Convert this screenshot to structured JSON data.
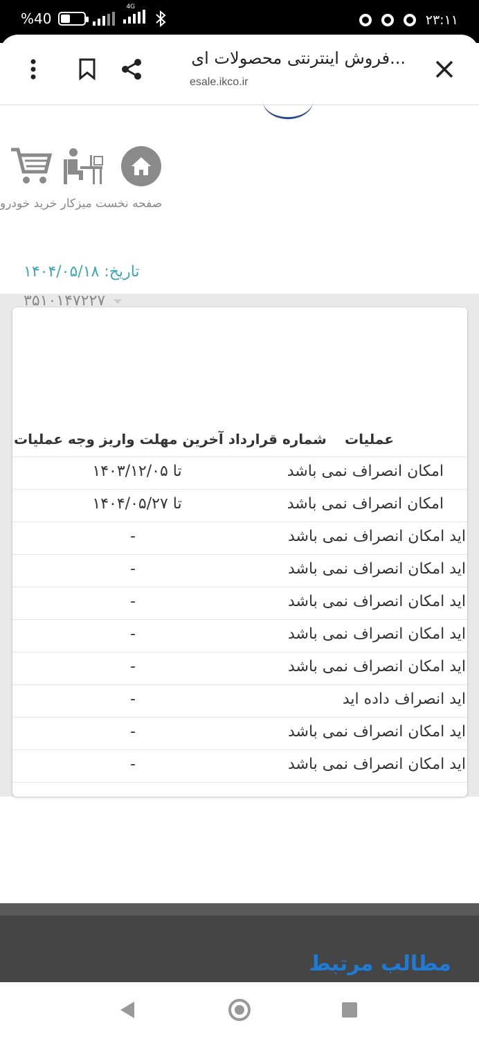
{
  "status_bar": {
    "battery": "%40",
    "battery_level": 0.4,
    "network": "4G",
    "time": "۲۳:۱۱"
  },
  "browser": {
    "title": "فروش اینترنتی محصولات ای...",
    "url": "esale.ikco.ir"
  },
  "nav": {
    "cart_icon": "cart-icon",
    "desk_icon": "desk-icon",
    "home_icon": "home-icon",
    "labels": "صفحه نخست میزکار خرید خودرو"
  },
  "date": "تاریخ: ۱۴۰۴/۰۵/۱۸",
  "partial_number": "۳۵۱۰۱۴۷۲۲۷",
  "table": {
    "headers": {
      "operations": "عملیات",
      "deadline": "شماره قرارداد آخرین مهلت واریز وجه عملیات"
    },
    "rows": [
      {
        "status": "امکان انصراف نمی باشد",
        "deadline": "تا ۱۴۰۳/۱۲/۰۵"
      },
      {
        "status": "امکان انصراف نمی باشد",
        "deadline": "تا ۱۴۰۴/۰۵/۲۷"
      },
      {
        "status": "اید امکان انصراف نمی باشد",
        "deadline": "-"
      },
      {
        "status": "اید امکان انصراف نمی باشد",
        "deadline": "-"
      },
      {
        "status": "اید امکان انصراف نمی باشد",
        "deadline": "-"
      },
      {
        "status": "اید امکان انصراف نمی باشد",
        "deadline": "-"
      },
      {
        "status": "اید امکان انصراف نمی باشد",
        "deadline": "-"
      },
      {
        "status": "اید      انصراف داده اید",
        "deadline": "-"
      },
      {
        "status": "اید امکان انصراف نمی باشد",
        "deadline": "-"
      },
      {
        "status": "اید امکان انصراف نمی باشد",
        "deadline": "-"
      }
    ]
  },
  "related_title": "مطالب مرتبط",
  "colors": {
    "accent_teal": "#3da7b8",
    "link_blue": "#1e7bd6",
    "icon_grey": "#8a8a8a"
  }
}
